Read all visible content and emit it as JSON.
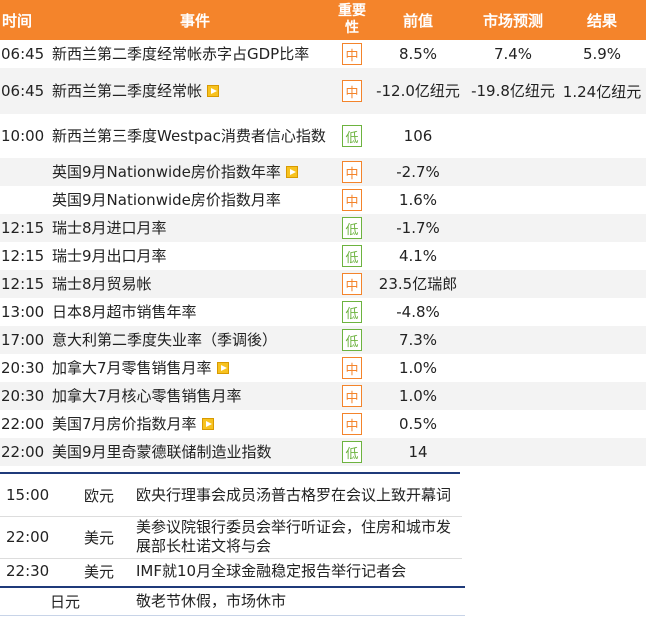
{
  "header": {
    "time": "时间",
    "event": "事件",
    "importance": "重要性",
    "importance_l1": "重要",
    "importance_l2": "性",
    "previous": "前值",
    "forecast": "市场预测",
    "actual": "结果"
  },
  "rows": [
    {
      "time": "06:45",
      "event": "新西兰第二季度经常帐赤字占GDP比率",
      "video": false,
      "importance": "中",
      "level": "mid",
      "previous": "8.5%",
      "forecast": "7.4%",
      "actual": "5.9%"
    },
    {
      "time": "06:45",
      "event": "新西兰第二季度经常帐",
      "video": true,
      "importance": "中",
      "level": "mid",
      "previous": "-12.0亿纽元",
      "forecast": "-19.8亿纽元",
      "actual": "1.24亿纽元"
    },
    {
      "time": "10:00",
      "event": "新西兰第三季度Westpac消费者信心指数",
      "video": false,
      "importance": "低",
      "level": "low",
      "previous": "106",
      "forecast": "",
      "actual": ""
    },
    {
      "time": "",
      "event": "英国9月Nationwide房价指数年率",
      "video": true,
      "importance": "中",
      "level": "mid",
      "previous": "-2.7%",
      "forecast": "",
      "actual": ""
    },
    {
      "time": "",
      "event": "英国9月Nationwide房价指数月率",
      "video": false,
      "importance": "中",
      "level": "mid",
      "previous": "1.6%",
      "forecast": "",
      "actual": ""
    },
    {
      "time": "12:15",
      "event": "瑞士8月进口月率",
      "video": false,
      "importance": "低",
      "level": "low",
      "previous": "-1.7%",
      "forecast": "",
      "actual": ""
    },
    {
      "time": "12:15",
      "event": "瑞士9月出口月率",
      "video": false,
      "importance": "低",
      "level": "low",
      "previous": "4.1%",
      "forecast": "",
      "actual": ""
    },
    {
      "time": "12:15",
      "event": "瑞士8月贸易帐",
      "video": false,
      "importance": "中",
      "level": "mid",
      "previous": "23.5亿瑞郎",
      "forecast": "",
      "actual": ""
    },
    {
      "time": "13:00",
      "event": "日本8月超市销售年率",
      "video": false,
      "importance": "低",
      "level": "low",
      "previous": "-4.8%",
      "forecast": "",
      "actual": ""
    },
    {
      "time": "17:00",
      "event": "意大利第二季度失业率（季调後）",
      "video": false,
      "importance": "低",
      "level": "low",
      "previous": "7.3%",
      "forecast": "",
      "actual": ""
    },
    {
      "time": "20:30",
      "event": "加拿大7月零售销售月率",
      "video": true,
      "importance": "中",
      "level": "mid",
      "previous": "1.0%",
      "forecast": "",
      "actual": ""
    },
    {
      "time": "20:30",
      "event": "加拿大7月核心零售销售月率",
      "video": false,
      "importance": "中",
      "level": "mid",
      "previous": "1.0%",
      "forecast": "",
      "actual": ""
    },
    {
      "time": "22:00",
      "event": "美国7月房价指数月率",
      "video": true,
      "importance": "中",
      "level": "mid",
      "previous": "0.5%",
      "forecast": "",
      "actual": ""
    },
    {
      "time": "22:00",
      "event": "美国9月里奇蒙德联储制造业指数",
      "video": false,
      "importance": "低",
      "level": "low",
      "previous": "14",
      "forecast": "",
      "actual": ""
    }
  ],
  "events": [
    {
      "time": "15:00",
      "currency": "欧元",
      "event": "欧央行理事会成员汤普古格罗在会议上致开幕词"
    },
    {
      "time": "22:00",
      "currency": "美元",
      "event": "美参议院银行委员会举行听证会，住房和城市发展部长杜诺文将与会"
    },
    {
      "time": "22:30",
      "currency": "美元",
      "event": "IMF就10月全球金融稳定报告举行记者会"
    }
  ],
  "holidays": [
    {
      "time": "",
      "currency": "日元",
      "event": "敬老节休假，市场休市"
    }
  ],
  "colors": {
    "header_bg": "#f4842b",
    "mid": "#f4842b",
    "low": "#6db33f",
    "bar": "#1f3a7a"
  }
}
